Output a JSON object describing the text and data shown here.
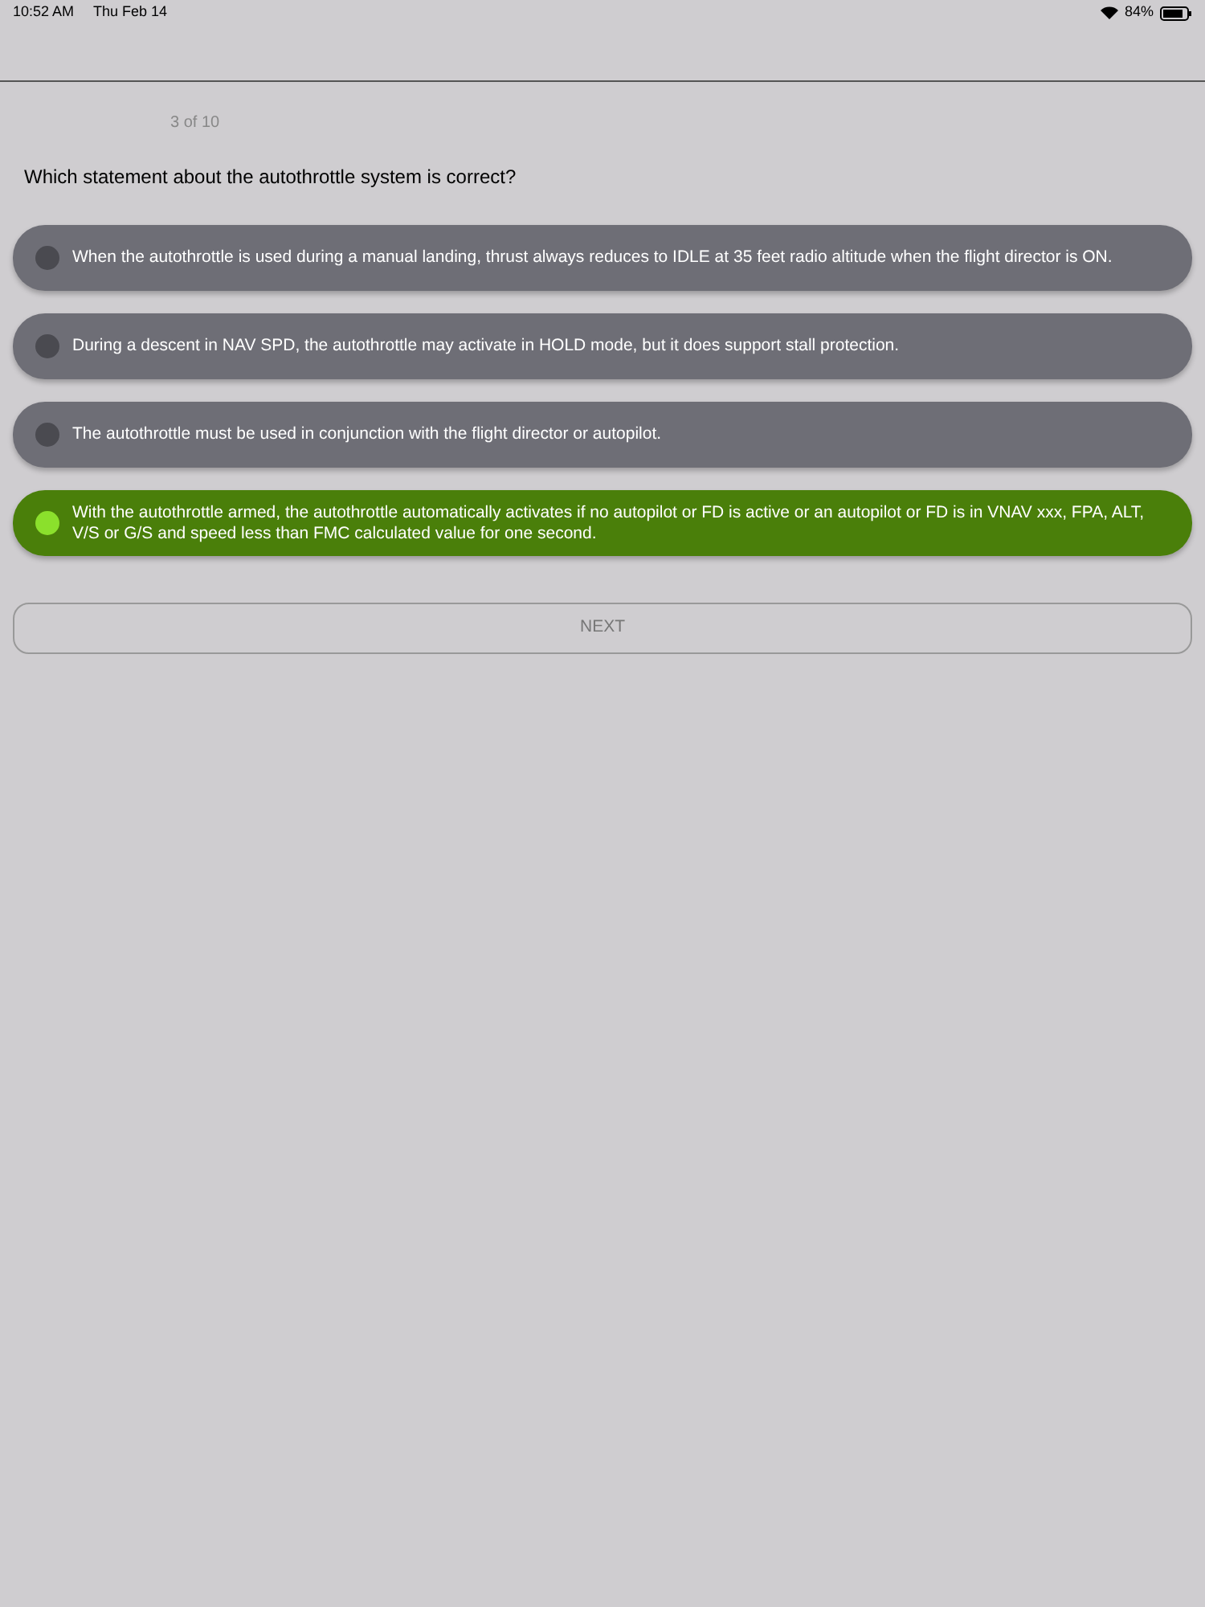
{
  "status_bar": {
    "time": "10:52 AM",
    "date": "Thu Feb 14",
    "battery": "84%"
  },
  "progress": "3 of 10",
  "question": "Which statement about the autothrottle system is correct?",
  "options": [
    {
      "text": "When the autothrottle is used during a manual landing, thrust always reduces to IDLE at 35 feet radio altitude when the flight director is ON.",
      "selected": false
    },
    {
      "text": "During a descent in NAV SPD, the autothrottle may activate in HOLD mode, but it does support stall protection.",
      "selected": false
    },
    {
      "text": "The autothrottle must be used in conjunction with the flight director or autopilot.",
      "selected": false
    },
    {
      "text": "With the autothrottle armed, the autothrottle automatically activates if no autopilot or FD is active or an autopilot or FD is in VNAV xxx, FPA, ALT, V/S or G/S and speed less than FMC calculated value for one second.",
      "selected": true
    }
  ],
  "next_button": {
    "label": "NEXT",
    "disabled": true
  }
}
